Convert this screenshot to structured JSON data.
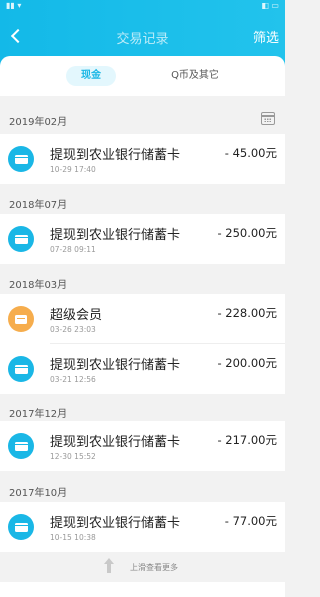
{
  "header": {
    "title": "交易记录",
    "filter_label": "筛选"
  },
  "tabs": [
    {
      "label": "现金",
      "active": true
    },
    {
      "label": "Q币及其它",
      "active": false
    }
  ],
  "months": [
    {
      "label": "2019年02月"
    },
    {
      "label": "2018年07月"
    },
    {
      "label": "2018年03月"
    },
    {
      "label": "2017年12月"
    },
    {
      "label": "2017年10月"
    }
  ],
  "transactions": [
    {
      "title": "提现到农业银行储蓄卡",
      "time": "10-29 17:40",
      "amount": "- 45.00元",
      "icon": "bank-card-icon"
    },
    {
      "title": "提现到农业银行储蓄卡",
      "time": "07-28 09:11",
      "amount": "- 250.00元",
      "icon": "bank-card-icon"
    },
    {
      "title": "超级会员",
      "time": "03-26 23:03",
      "amount": "- 228.00元",
      "icon": "vip-icon"
    },
    {
      "title": "提现到农业银行储蓄卡",
      "time": "03-21 12:56",
      "amount": "- 200.00元",
      "icon": "bank-card-icon"
    },
    {
      "title": "提现到农业银行储蓄卡",
      "time": "12-30 15:52",
      "amount": "- 217.00元",
      "icon": "bank-card-icon"
    },
    {
      "title": "提现到农业银行储蓄卡",
      "time": "10-15 10:38",
      "amount": "- 77.00元",
      "icon": "bank-card-icon"
    }
  ],
  "footer": {
    "more_label": "上滑查看更多"
  },
  "colors": {
    "accent": "#1ab7e6",
    "vip": "#f6ad4d"
  }
}
